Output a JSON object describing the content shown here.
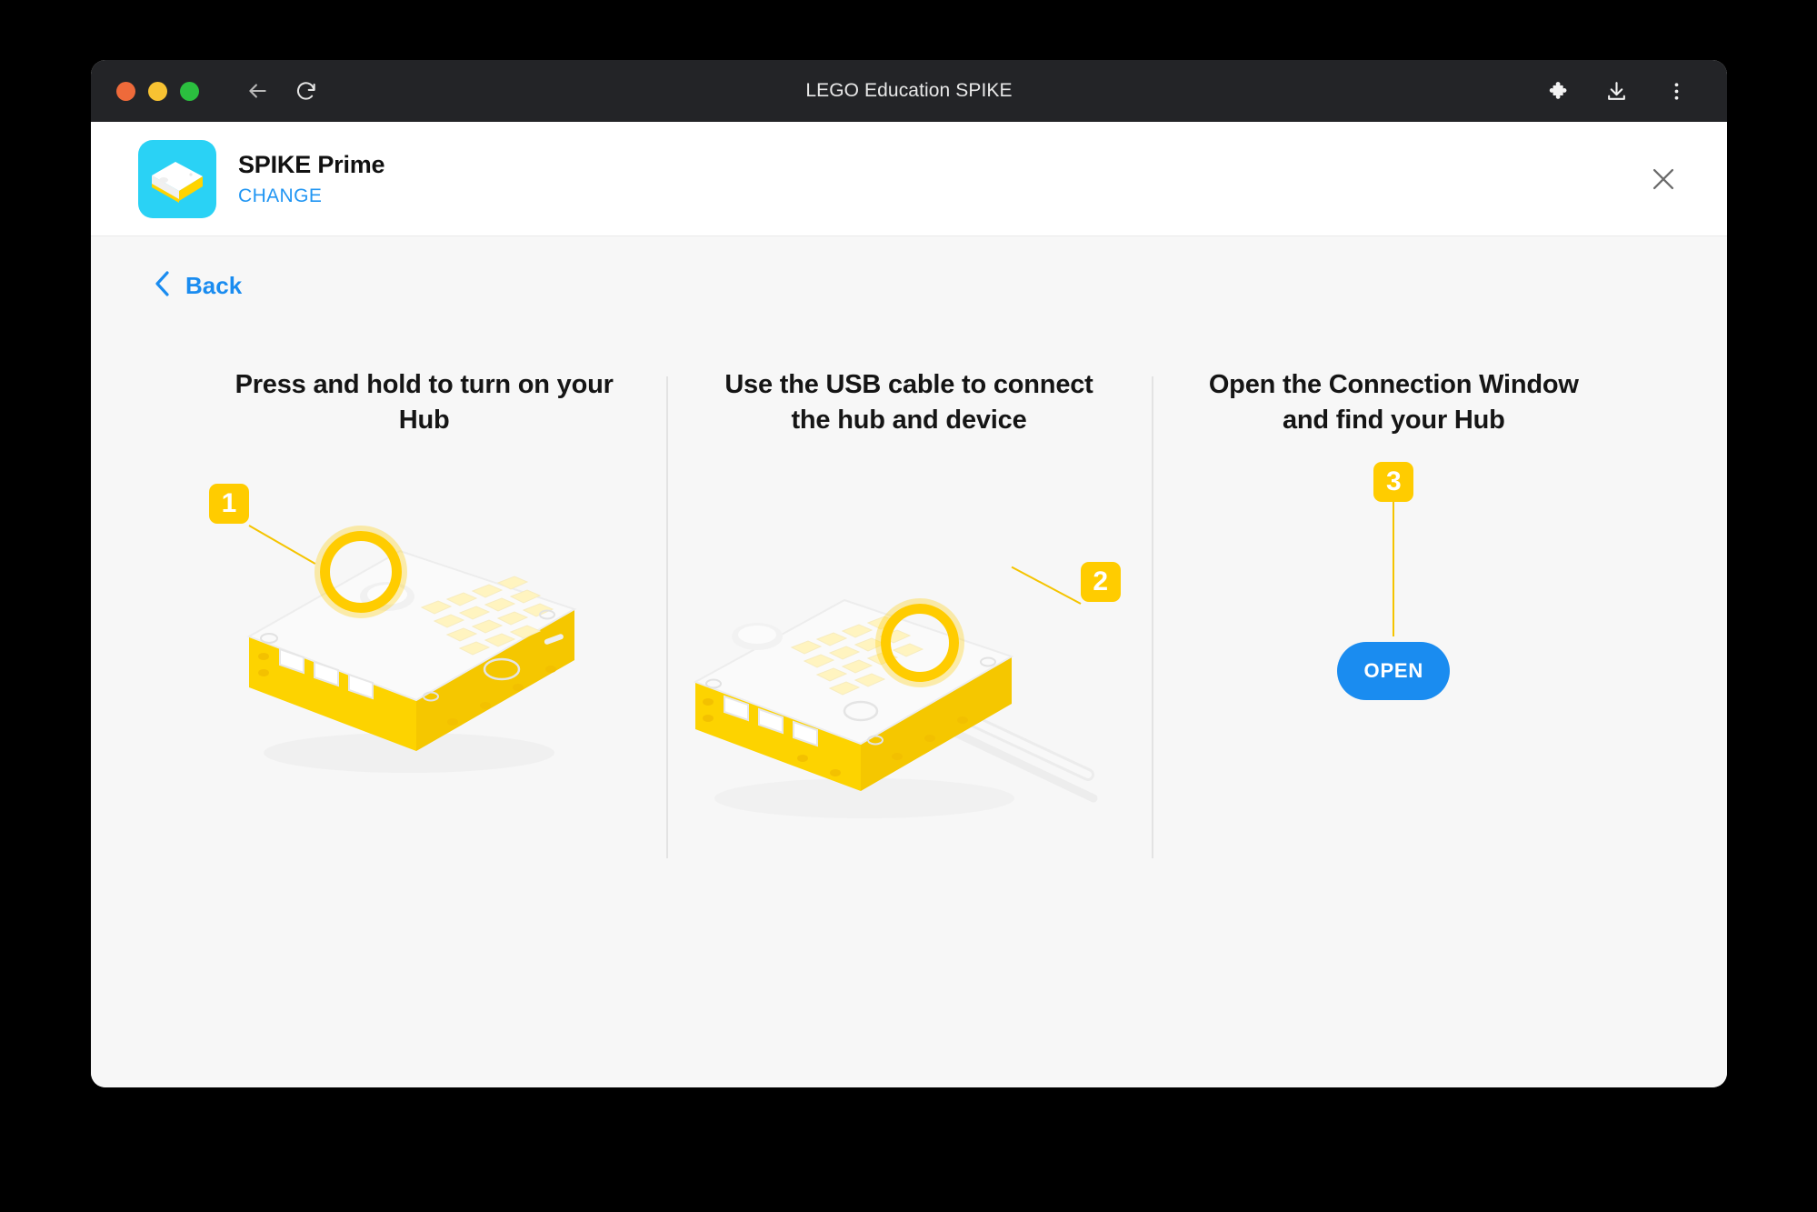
{
  "window": {
    "title": "LEGO Education SPIKE",
    "traffic_lights": [
      {
        "name": "close",
        "color": "#ee6a3a"
      },
      {
        "name": "minimize",
        "color": "#f7c232"
      },
      {
        "name": "maximize",
        "color": "#2bbf3f"
      }
    ],
    "nav": [
      {
        "name": "back-arrow-icon"
      },
      {
        "name": "reload-icon"
      }
    ],
    "toolbar_right": [
      {
        "name": "extensions-puzzle-icon"
      },
      {
        "name": "download-icon"
      },
      {
        "name": "more-menu-icon"
      }
    ]
  },
  "header": {
    "device_name": "SPIKE Prime",
    "change_label": "CHANGE",
    "close_icon": "close-icon",
    "tile_icon": "spike-prime-hub-icon",
    "tile_color": "#2ad2f5"
  },
  "nav": {
    "back_label": "Back",
    "back_icon": "chevron-left-icon"
  },
  "steps": [
    {
      "number": "1",
      "title": "Press and hold to turn on your Hub",
      "art": "hub-power-button"
    },
    {
      "number": "2",
      "title": "Use the USB cable to connect the hub and device",
      "art": "hub-usb-cable"
    },
    {
      "number": "3",
      "title": "Open the Connection Window and find your Hub",
      "art": "open-button",
      "button_label": "OPEN"
    }
  ],
  "colors": {
    "accent_blue": "#1a8cf0",
    "link_blue": "#2196f3",
    "lego_yellow": "#ffcc00",
    "badge_text": "#ffffff",
    "page_bg": "#f7f7f7",
    "titlebar_bg": "#232427"
  }
}
